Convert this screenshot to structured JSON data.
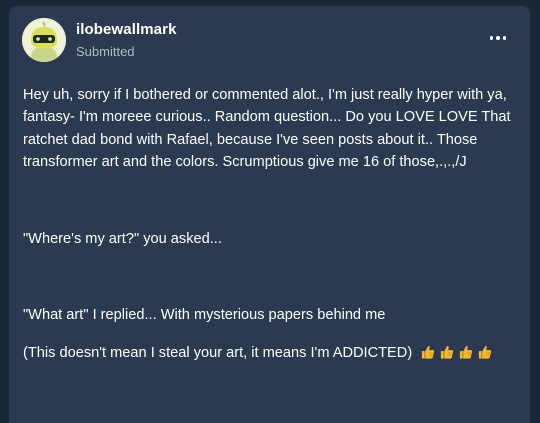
{
  "post": {
    "username": "ilobewallmark",
    "status": "Submitted",
    "menu_icon": "more-horizontal-icon",
    "avatar_icon": "avatar-character-icon",
    "paragraphs": [
      "Hey uh, sorry if I bothered or commented alot., I'm just really hyper with ya, fantasy- I'm moreee curious.. Random question... Do you LOVE LOVE That ratchet dad bond with Rafael, because I've seen posts about it.. Those transformer art and the colors. Scrumptious give me 16 of those,.,.,/J",
      "\"Where's my art?\" you asked...",
      "\"What art\" I replied... With mysterious papers behind me",
      "(This doesn't mean I steal your art, it means I'm ADDICTED)"
    ],
    "emoji_icon": "thumbs-up-icon",
    "emoji_count": 4
  },
  "colors": {
    "page_bg": "#1b2636",
    "card_bg": "#2b3a50",
    "text": "#ffffff",
    "muted": "#b0bac7",
    "thumb": "#f5b731"
  }
}
